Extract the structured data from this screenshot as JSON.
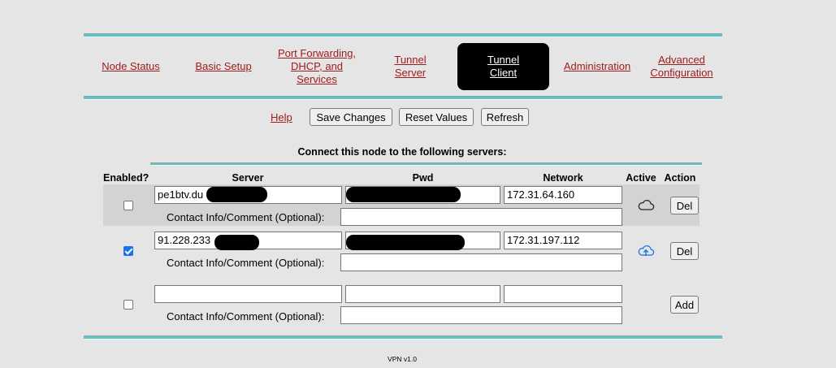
{
  "nav": {
    "items": [
      {
        "lines": [
          "Node Status"
        ]
      },
      {
        "lines": [
          "Basic Setup"
        ]
      },
      {
        "lines": [
          "Port Forwarding,",
          "DHCP, and",
          "Services"
        ]
      },
      {
        "lines": [
          "Tunnel",
          "Server"
        ]
      },
      {
        "lines": [
          "Tunnel",
          "Client"
        ],
        "active": true
      },
      {
        "lines": [
          "Administration"
        ]
      },
      {
        "lines": [
          "Advanced",
          "Configuration"
        ]
      }
    ]
  },
  "toolbar": {
    "help": "Help",
    "save": "Save Changes",
    "reset": "Reset Values",
    "refresh": "Refresh"
  },
  "heading": "Connect this node to the following servers:",
  "columns": {
    "enabled": "Enabled?",
    "server": "Server",
    "pwd": "Pwd",
    "network": "Network",
    "active": "Active",
    "action": "Action"
  },
  "contact_label": "Contact Info/Comment (Optional):",
  "rows": [
    {
      "enabled": false,
      "server": "pe1btv.du",
      "pwd": "",
      "network": "172.31.64.160",
      "contact": "",
      "active_icon": "cloud-outline-icon",
      "action": "Del"
    },
    {
      "enabled": true,
      "server": "91.228.233",
      "pwd": "",
      "network": "172.31.197.112",
      "contact": "",
      "active_icon": "cloud-upload-icon",
      "action": "Del"
    },
    {
      "enabled": false,
      "server": "",
      "pwd": "",
      "network": "",
      "contact": "",
      "active_icon": "",
      "action": "Add"
    }
  ],
  "footer": "VPN v1.0",
  "colors": {
    "link": "#a01c1c",
    "rule": "#5bc6c6",
    "checkbox_on": "#1a73e8",
    "active_icon": "#1a73e8"
  }
}
